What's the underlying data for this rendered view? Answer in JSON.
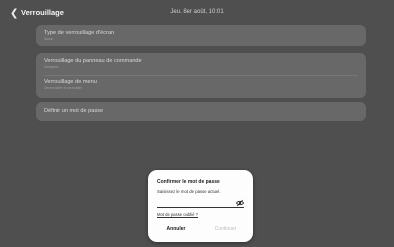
{
  "header": {
    "back_icon": "chevron-left-icon",
    "title": "Verrouillage",
    "datetime": "Jeu. 8er août, 10:01"
  },
  "settings": {
    "lock_type": {
      "label": "Type de verrouillage d'écran",
      "value": "Aucun"
    },
    "control_panel_lock": {
      "label": "Verrouillage du panneau de commande",
      "value": "Désactivé"
    },
    "menu_lock": {
      "label": "Verrouillage de menu",
      "value": "Déverrouiller et verrouiller"
    },
    "set_password": {
      "label": "Définir un mot de passe"
    }
  },
  "dialog": {
    "title": "Confirmer le mot de passe",
    "message": "Saisissez le mot de passe actuel.",
    "password_value": "",
    "visibility_icon": "eye-slash-icon",
    "forgot_link": "Mot de passe oublié ?",
    "cancel_label": "Annuler",
    "continue_label": "Continuer"
  }
}
